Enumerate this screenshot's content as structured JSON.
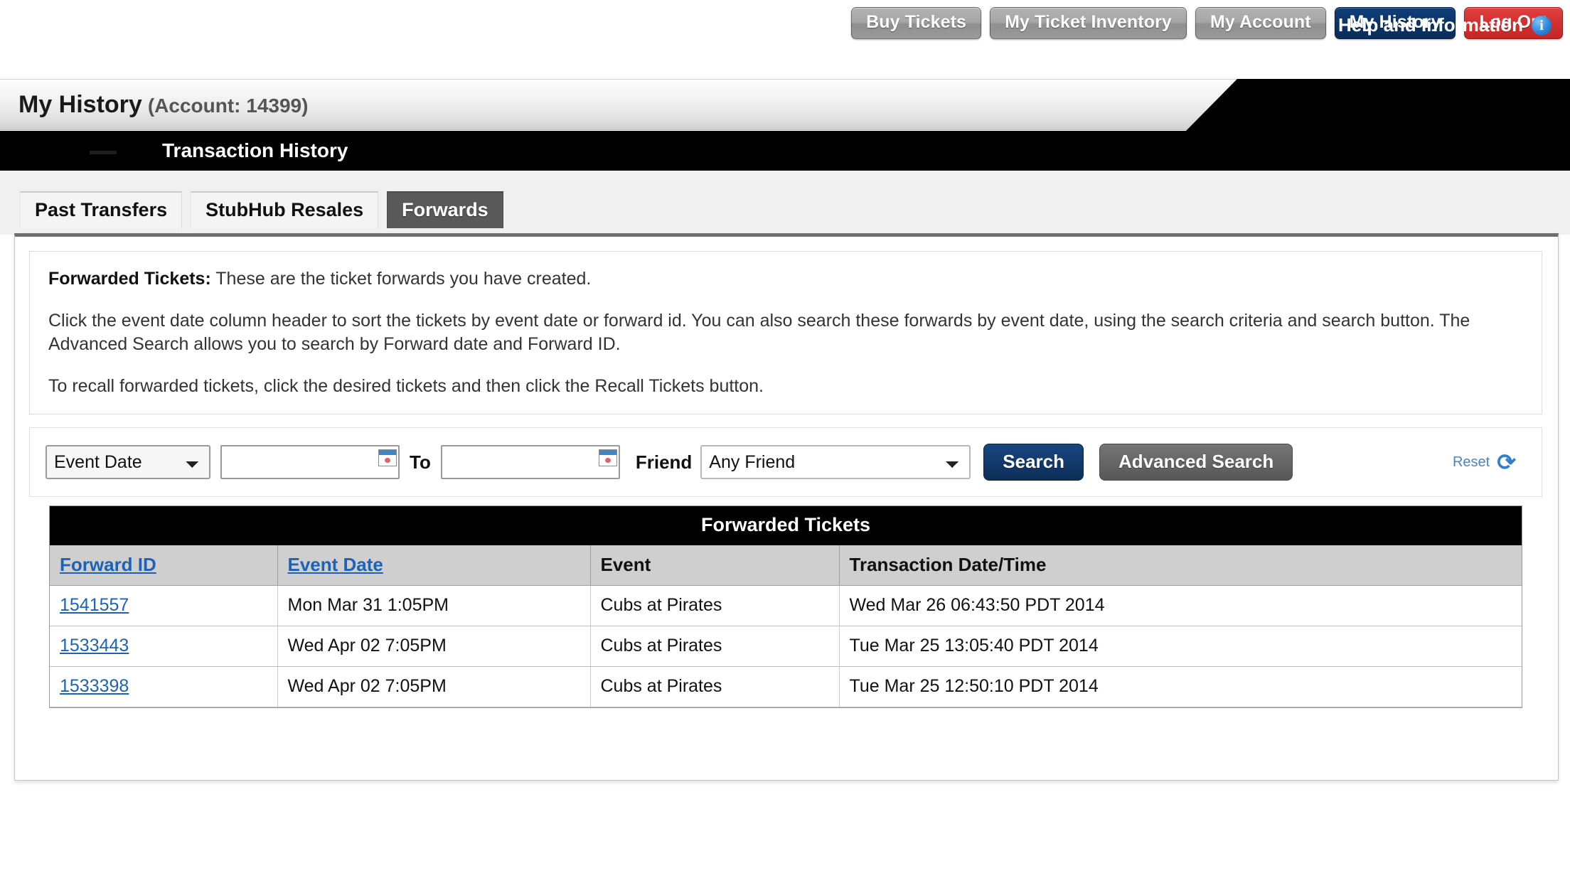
{
  "topnav": {
    "buttons": [
      {
        "label": "Buy Tickets",
        "style": "grey"
      },
      {
        "label": "My Ticket Inventory",
        "style": "grey"
      },
      {
        "label": "My Account",
        "style": "grey"
      },
      {
        "label": "My History",
        "style": "blue"
      },
      {
        "label": "Log Out",
        "style": "red"
      }
    ]
  },
  "header": {
    "title": "My History",
    "account": "(Account: 14399)",
    "help_label": "Help and Information",
    "help_icon": "info-icon",
    "subbar_label": "Transaction History"
  },
  "tabs": [
    {
      "label": "Past Transfers",
      "active": false
    },
    {
      "label": "StubHub Resales",
      "active": false
    },
    {
      "label": "Forwards",
      "active": true
    }
  ],
  "instructions": {
    "line1_bold": "Forwarded Tickets:",
    "line1_rest": " These are the ticket forwards you have created.",
    "line2": "Click the event date column header to sort the tickets by event date or forward id. You can also search these forwards by event date, using the search criteria and search button. The Advanced Search allows you to search by Forward date and Forward ID.",
    "line3": "To recall forwarded tickets, click the desired tickets and then click the Recall Tickets button."
  },
  "search": {
    "date_type_selected": "Event Date",
    "date_type_options": [
      "Event Date"
    ],
    "date_from_value": "",
    "date_from_placeholder": "",
    "to_label": "To",
    "date_to_value": "",
    "date_to_placeholder": "",
    "calendar_icon": "calendar-icon",
    "friend_label": "Friend",
    "friend_selected": "Any Friend",
    "friend_options": [
      "Any Friend"
    ],
    "search_button": "Search",
    "advanced_button": "Advanced Search",
    "reset_label": "Reset",
    "reset_icon": "refresh-icon"
  },
  "results": {
    "title": "Forwarded Tickets",
    "columns": [
      {
        "label": "Forward ID",
        "sortable": true
      },
      {
        "label": "Event Date",
        "sortable": true
      },
      {
        "label": "Event",
        "sortable": false
      },
      {
        "label": "Transaction Date/Time",
        "sortable": false
      }
    ],
    "rows": [
      {
        "forward_id": "1541557",
        "event_date": "Mon Mar 31 1:05PM",
        "event": "Cubs at Pirates",
        "transaction_datetime": "Wed Mar 26 06:43:50 PDT 2014"
      },
      {
        "forward_id": "1533443",
        "event_date": "Wed Apr 02 7:05PM",
        "event": "Cubs at Pirates",
        "transaction_datetime": "Tue Mar 25 13:05:40 PDT 2014"
      },
      {
        "forward_id": "1533398",
        "event_date": "Wed Apr 02 7:05PM",
        "event": "Cubs at Pirates",
        "transaction_datetime": "Tue Mar 25 12:50:10 PDT 2014"
      }
    ]
  },
  "colors": {
    "accent_blue": "#12396a",
    "link_blue": "#1c63b8",
    "logout_red": "#d32f2f",
    "active_tab_grey": "#595959",
    "header_black": "#000000"
  }
}
